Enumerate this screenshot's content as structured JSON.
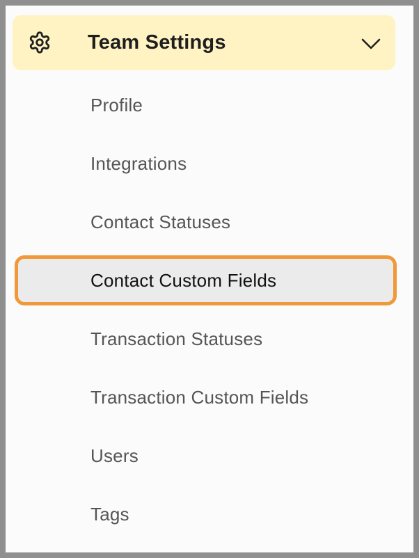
{
  "header": {
    "title": "Team Settings",
    "icon": "gear-icon",
    "expand_icon": "chevron-down-icon",
    "background": "#fff3c4"
  },
  "menu": {
    "items": [
      {
        "label": "Profile"
      },
      {
        "label": "Integrations"
      },
      {
        "label": "Contact Statuses"
      },
      {
        "label": "Contact Custom Fields",
        "selected": true
      },
      {
        "label": "Transaction Statuses"
      },
      {
        "label": "Transaction Custom Fields"
      },
      {
        "label": "Users"
      },
      {
        "label": "Tags"
      }
    ],
    "highlight_color": "#f0993a"
  }
}
